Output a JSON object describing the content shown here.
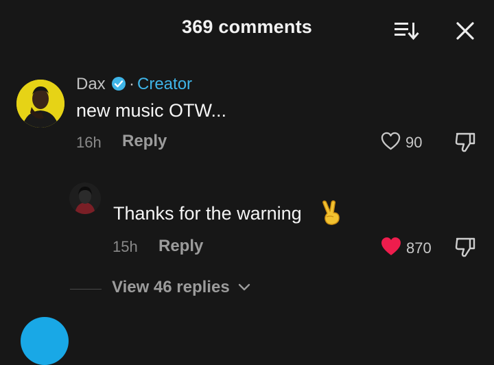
{
  "header": {
    "title": "369 comments",
    "sort_icon": "sort-icon",
    "close_icon": "close-icon"
  },
  "comment": {
    "username": "Dax",
    "verified": true,
    "separator": "·",
    "creator_label": "Creator",
    "text": "new music OTW...",
    "timestamp": "16h",
    "reply_label": "Reply",
    "likes": "90",
    "liked": false
  },
  "reply": {
    "text": "Thanks for the warning",
    "emoji": "victory-hand-icon",
    "timestamp": "15h",
    "reply_label": "Reply",
    "likes": "870",
    "liked": true
  },
  "view_replies": {
    "label": "View 46 replies"
  },
  "colors": {
    "background": "#171717",
    "accent_blue": "#3fb5e8",
    "like_red": "#ee1d4d",
    "secondary_text": "#9c9c9c"
  }
}
